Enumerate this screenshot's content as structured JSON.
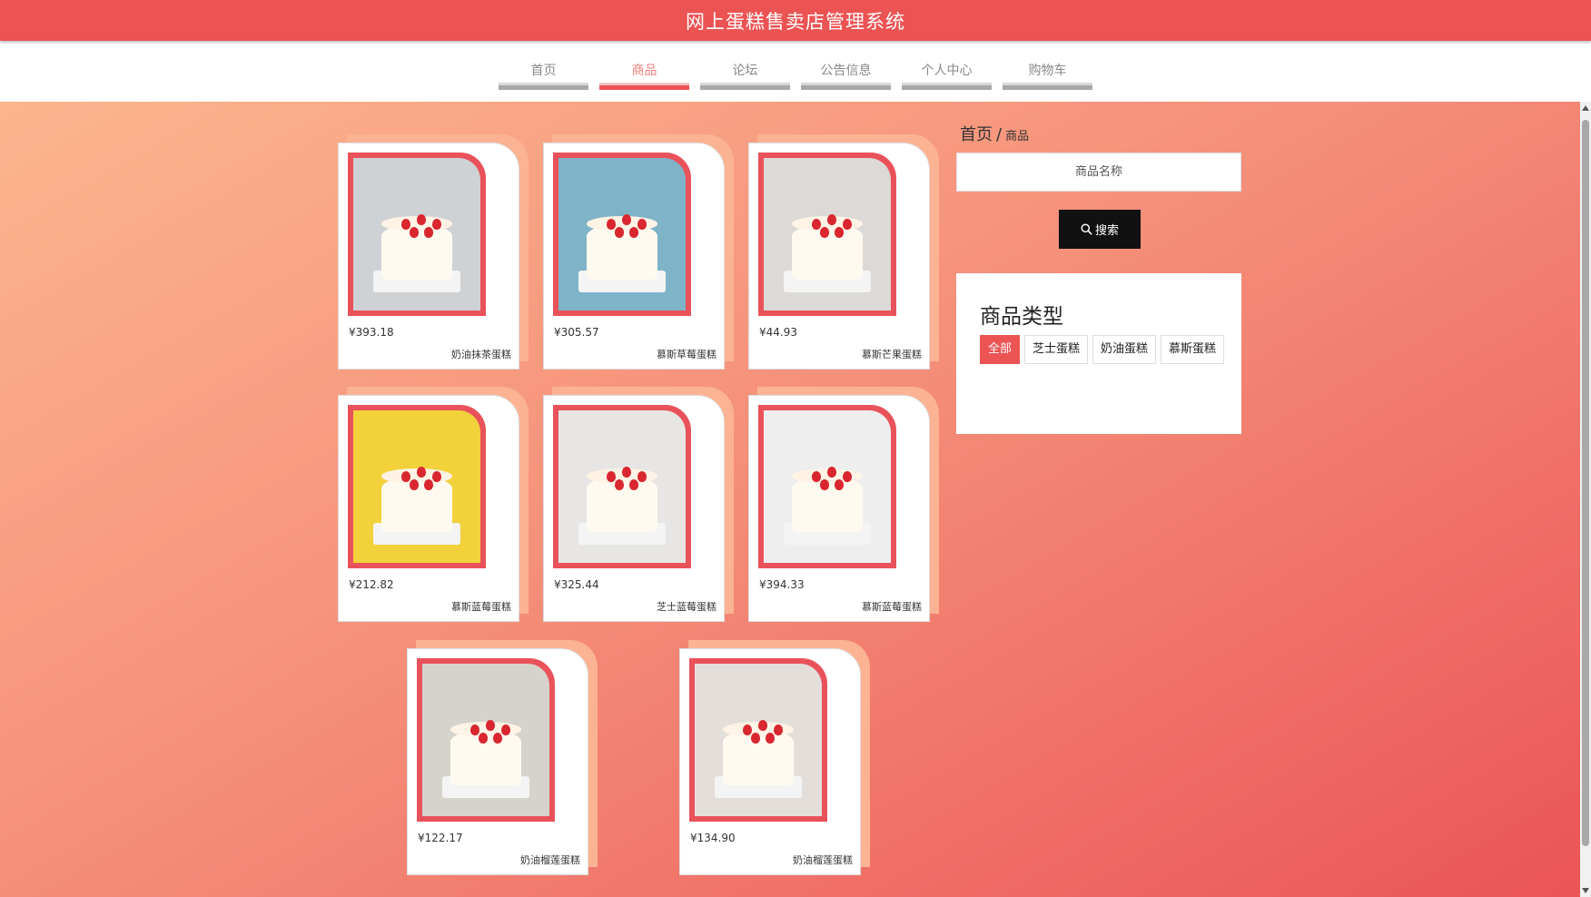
{
  "header": {
    "title": "网上蛋糕售卖店管理系统"
  },
  "nav": [
    {
      "label": "首页",
      "active": false
    },
    {
      "label": "商品",
      "active": true
    },
    {
      "label": "论坛",
      "active": false
    },
    {
      "label": "公告信息",
      "active": false
    },
    {
      "label": "个人中心",
      "active": false
    },
    {
      "label": "购物车",
      "active": false
    }
  ],
  "products": [
    {
      "price": "¥393.18",
      "name": "奶油抹茶蛋糕",
      "bg": "#cfd2d4"
    },
    {
      "price": "¥305.57",
      "name": "慕斯草莓蛋糕",
      "bg": "#7fb3c8"
    },
    {
      "price": "¥44.93",
      "name": "慕斯芒果蛋糕",
      "bg": "#dcd9d6"
    },
    {
      "price": "¥212.82",
      "name": "慕斯蓝莓蛋糕",
      "bg": "#f2d13a"
    },
    {
      "price": "¥325.44",
      "name": "芝士蓝莓蛋糕",
      "bg": "#e8e6e4"
    },
    {
      "price": "¥394.33",
      "name": "慕斯蓝莓蛋糕",
      "bg": "#eeeeee"
    },
    {
      "price": "¥122.17",
      "name": "奶油榴莲蛋糕",
      "bg": "#d6d3cc"
    },
    {
      "price": "¥134.90",
      "name": "奶油榴莲蛋糕",
      "bg": "#e4dedb"
    }
  ],
  "breadcrumb": {
    "home": "首页",
    "separator": "/",
    "current": "商品"
  },
  "search": {
    "placeholder": "商品名称",
    "button_label": "搜索"
  },
  "categories": {
    "title": "商品类型",
    "items": [
      {
        "label": "全部",
        "active": true
      },
      {
        "label": "芝士蛋糕",
        "active": false
      },
      {
        "label": "奶油蛋糕",
        "active": false
      },
      {
        "label": "慕斯蛋糕",
        "active": false
      }
    ]
  }
}
